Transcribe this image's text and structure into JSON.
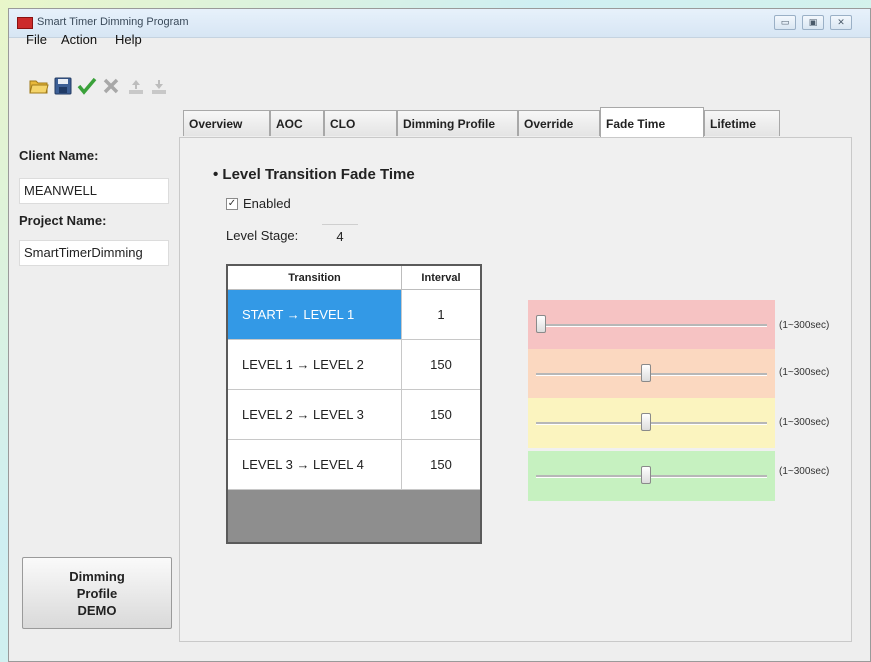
{
  "window": {
    "title": "Smart Timer Dimming Program",
    "controls": [
      "▭",
      "▣",
      "✕"
    ]
  },
  "menu": [
    "File",
    "Action",
    "Help"
  ],
  "toolbar": [
    "open-folder",
    "save",
    "confirm-check",
    "cancel-x",
    "upload",
    "download"
  ],
  "sidebar": {
    "client_label": "Client Name:",
    "client_value": "MEANWELL",
    "project_label": "Project Name:",
    "project_value": "SmartTimerDimming",
    "demo_button": [
      "Dimming",
      "Profile",
      "DEMO"
    ]
  },
  "tabs": [
    {
      "label": "Overview"
    },
    {
      "label": "AOC"
    },
    {
      "label": "CLO"
    },
    {
      "label": "Dimming Profile"
    },
    {
      "label": "Override"
    },
    {
      "label": "Fade Time",
      "active": true
    },
    {
      "label": "Lifetime"
    }
  ],
  "fade": {
    "section_title": "• Level Transition Fade Time",
    "enabled_label": "Enabled",
    "enabled": true,
    "stage_label": "Level Stage:",
    "stage_value": "4",
    "columns": [
      "Transition",
      "Interval"
    ],
    "rows": [
      {
        "transition": "START → LEVEL 1",
        "interval": "1",
        "selected": true
      },
      {
        "transition": "LEVEL 1 → LEVEL 2",
        "interval": "150"
      },
      {
        "transition": "LEVEL 2 → LEVEL 3",
        "interval": "150"
      },
      {
        "transition": "LEVEL 3 → LEVEL 4",
        "interval": "150"
      }
    ],
    "sliders": [
      {
        "value": 1,
        "min": 1,
        "max": 300,
        "color": "#f6c3c3",
        "range_label": "(1~300sec)"
      },
      {
        "value": 150,
        "min": 1,
        "max": 300,
        "color": "#fbd8c0",
        "range_label": "(1~300sec)"
      },
      {
        "value": 150,
        "min": 1,
        "max": 300,
        "color": "#fbf4bf",
        "range_label": "(1~300sec)"
      },
      {
        "value": 150,
        "min": 1,
        "max": 300,
        "color": "#c6f1c0",
        "range_label": "(1~300sec)"
      }
    ]
  },
  "colors": {
    "selection": "#3399e6",
    "grid_empty": "#8e8e8e",
    "app_icon": "#cc2b2b"
  }
}
